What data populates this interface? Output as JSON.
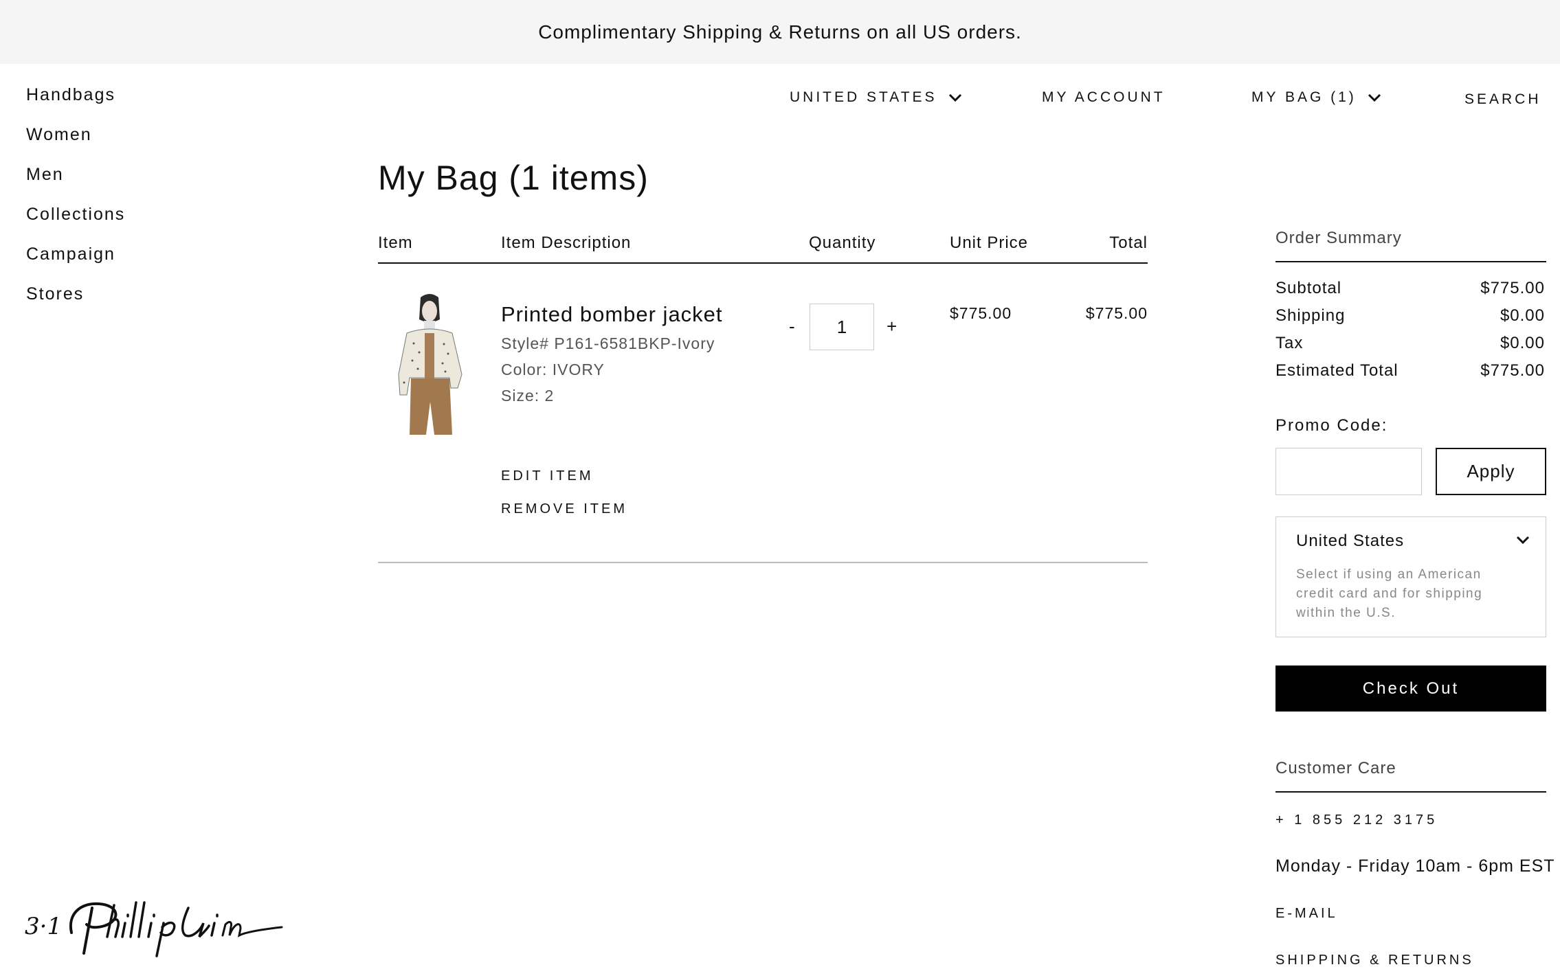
{
  "banner": {
    "text": "Complimentary Shipping & Returns on all US orders."
  },
  "sidebar": {
    "items": [
      {
        "label": "Handbags"
      },
      {
        "label": "Women"
      },
      {
        "label": "Men"
      },
      {
        "label": "Collections"
      },
      {
        "label": "Campaign"
      },
      {
        "label": "Stores"
      }
    ]
  },
  "header": {
    "country": "UNITED STATES",
    "account": "MY ACCOUNT",
    "bag": "MY BAG (1)",
    "search": "SEARCH"
  },
  "cart": {
    "title": "My Bag (1 items)",
    "columns": {
      "item": "Item",
      "description": "Item Description",
      "quantity": "Quantity",
      "unit_price": "Unit Price",
      "total": "Total"
    },
    "items": [
      {
        "name": "Printed bomber jacket",
        "style": "Style# P161-6581BKP-Ivory",
        "color": "Color: IVORY",
        "size": "Size: 2",
        "quantity": "1",
        "qty_minus": "-",
        "qty_plus": "+",
        "unit_price": "$775.00",
        "total": "$775.00",
        "edit_label": "EDIT ITEM",
        "remove_label": "REMOVE ITEM"
      }
    ]
  },
  "summary": {
    "title": "Order Summary",
    "rows": [
      {
        "label": "Subtotal",
        "value": "$775.00"
      },
      {
        "label": "Shipping",
        "value": "$0.00"
      },
      {
        "label": "Tax",
        "value": "$0.00"
      },
      {
        "label": "Estimated Total",
        "value": "$775.00"
      }
    ],
    "promo_label": "Promo Code:",
    "promo_value": "",
    "apply_label": "Apply",
    "country_selected": "United States",
    "country_help": "Select if using an American credit card and for shipping within the U.S.",
    "checkout_label": "Check Out"
  },
  "care": {
    "title": "Customer Care",
    "phone": "+ 1 855 212 3175",
    "hours": "Monday - Friday 10am - 6pm EST",
    "email": "E-MAIL",
    "shipping": "SHIPPING & RETURNS"
  },
  "logo": {
    "text": "3.1 Phillip Lim"
  },
  "icons": {
    "country_chevron": "chevron-down-icon",
    "bag_chevron": "chevron-down-icon",
    "select_chevron": "chevron-down-icon"
  }
}
